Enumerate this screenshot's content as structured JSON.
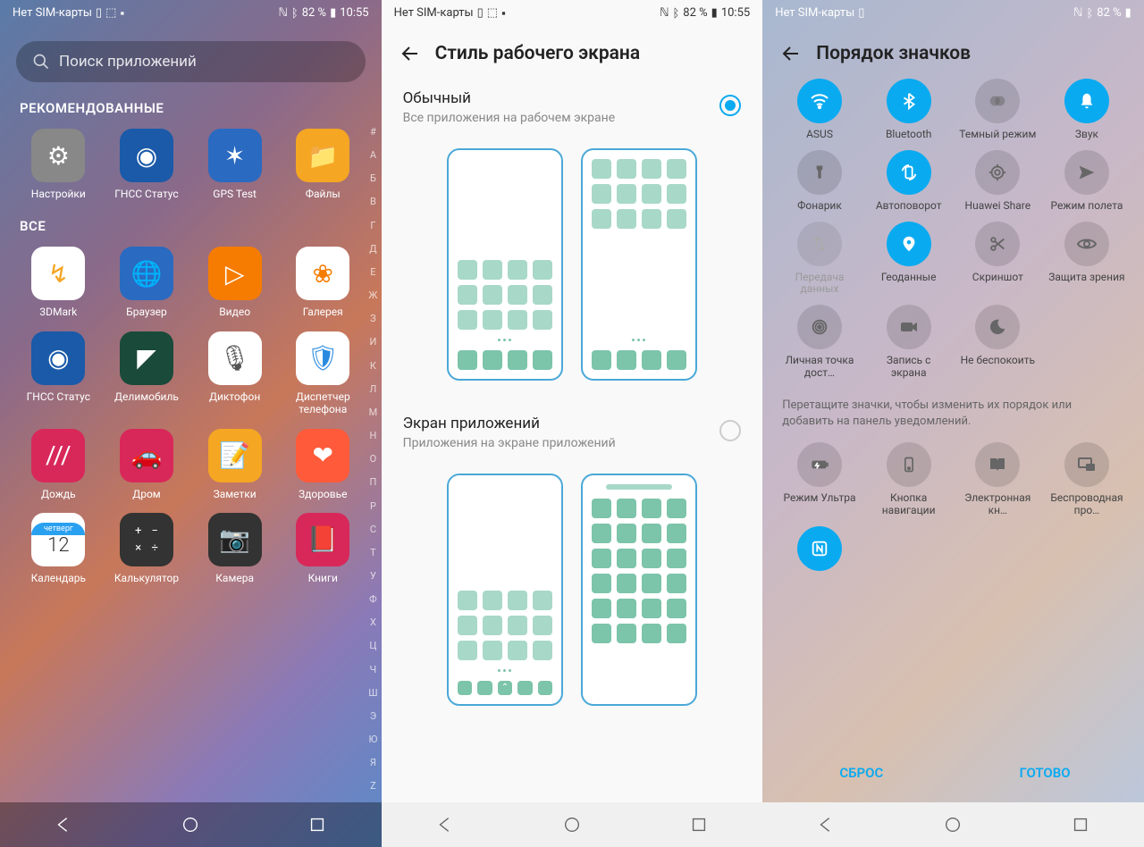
{
  "status": {
    "sim": "Нет SIM-карты",
    "nfc": "ℕ",
    "bt": "82 %",
    "time": "10:55",
    "time3": ""
  },
  "phone1": {
    "search_placeholder": "Поиск приложений",
    "section_recommended": "РЕКОМЕНДОВАННЫЕ",
    "section_all": "ВСЕ",
    "recommended": [
      {
        "label": "Настройки",
        "bg": "#888",
        "icon": "⚙"
      },
      {
        "label": "ГНСС Статус",
        "bg": "#1a5aa8",
        "icon": "◉"
      },
      {
        "label": "GPS Test",
        "bg": "#2a6ac0",
        "icon": "✶"
      },
      {
        "label": "Файлы",
        "bg": "#f5a623",
        "icon": "📁"
      }
    ],
    "all": [
      {
        "label": "3DMark",
        "bg": "#fff",
        "icon": "↯",
        "fg": "#f5a623"
      },
      {
        "label": "Браузер",
        "bg": "#2a6ac0",
        "icon": "🌐"
      },
      {
        "label": "Видео",
        "bg": "#f57c00",
        "icon": "▷"
      },
      {
        "label": "Галерея",
        "bg": "#fff",
        "icon": "❀",
        "fg": "#f57c00"
      },
      {
        "label": "ГНСС Статус",
        "bg": "#1a5aa8",
        "icon": "◉"
      },
      {
        "label": "Делимобиль",
        "bg": "#1a4a3a",
        "icon": "◤"
      },
      {
        "label": "Диктофон",
        "bg": "#fff",
        "icon": "🎙",
        "fg": "#555"
      },
      {
        "label": "Диспетчер телефона",
        "bg": "#fff",
        "icon": "🛡",
        "fg": "#2a8ae0"
      },
      {
        "label": "Дождь",
        "bg": "#d8285a",
        "icon": "///"
      },
      {
        "label": "Дром",
        "bg": "#d8285a",
        "icon": "🚗"
      },
      {
        "label": "Заметки",
        "bg": "#f5a623",
        "icon": "📝"
      },
      {
        "label": "Здоровье",
        "bg": "#ff5a3a",
        "icon": "❤"
      },
      {
        "label": "Календарь",
        "bg": "#fff",
        "icon": "cal"
      },
      {
        "label": "Калькулятор",
        "bg": "#333",
        "icon": "calc"
      },
      {
        "label": "Камера",
        "bg": "#333",
        "icon": "📷"
      },
      {
        "label": "Книги",
        "bg": "#d8285a",
        "icon": "📕"
      }
    ],
    "calendar": {
      "day": "четверг",
      "num": "12"
    },
    "alpha_index": [
      "#",
      "А",
      "Б",
      "В",
      "Г",
      "Д",
      "Е",
      "Ж",
      "З",
      "И",
      "К",
      "Л",
      "М",
      "Н",
      "О",
      "П",
      "Р",
      "С",
      "Т",
      "У",
      "Ф",
      "Х",
      "Ц",
      "Ч",
      "Ш",
      "Э",
      "Ю",
      "Я",
      "Z"
    ]
  },
  "phone2": {
    "title": "Стиль рабочего экрана",
    "options": [
      {
        "title": "Обычный",
        "sub": "Все приложения на рабочем экране",
        "selected": true
      },
      {
        "title": "Экран приложений",
        "sub": "Приложения на экране приложений",
        "selected": false
      }
    ]
  },
  "phone3": {
    "title": "Порядок значков",
    "tiles": [
      {
        "label": "ASUS",
        "icon": "wifi",
        "state": "on"
      },
      {
        "label": "Bluetooth",
        "icon": "bt",
        "state": "on"
      },
      {
        "label": "Темный режим",
        "icon": "dark",
        "state": "off"
      },
      {
        "label": "Звук",
        "icon": "bell",
        "state": "on"
      },
      {
        "label": "Фонарик",
        "icon": "torch",
        "state": "off"
      },
      {
        "label": "Автоповорот",
        "icon": "rotate",
        "state": "on"
      },
      {
        "label": "Huawei Share",
        "icon": "share",
        "state": "off"
      },
      {
        "label": "Режим полета",
        "icon": "plane",
        "state": "off"
      },
      {
        "label": "Передача данных",
        "icon": "data",
        "state": "disabled"
      },
      {
        "label": "Геоданные",
        "icon": "pin",
        "state": "on"
      },
      {
        "label": "Скриншот",
        "icon": "scissors",
        "state": "off"
      },
      {
        "label": "Защита зрения",
        "icon": "eye",
        "state": "off"
      },
      {
        "label": "Личная точка дост…",
        "icon": "hotspot",
        "state": "off"
      },
      {
        "label": "Запись с экрана",
        "icon": "rec",
        "state": "off"
      },
      {
        "label": "Не беспокоить",
        "icon": "moon",
        "state": "off"
      }
    ],
    "hint": "Перетащите значки, чтобы изменить их порядок или добавить на панель уведомлений.",
    "extra_tiles": [
      {
        "label": "Режим Ультра",
        "icon": "ultra",
        "state": "off"
      },
      {
        "label": "Кнопка навигации",
        "icon": "navbtn",
        "state": "off"
      },
      {
        "label": "Электронная кн…",
        "icon": "book",
        "state": "off"
      },
      {
        "label": "Беспроводная про…",
        "icon": "cast",
        "state": "off"
      },
      {
        "label": "",
        "icon": "nfc",
        "state": "on"
      }
    ],
    "buttons": {
      "reset": "СБРОС",
      "done": "ГОТОВО"
    }
  }
}
